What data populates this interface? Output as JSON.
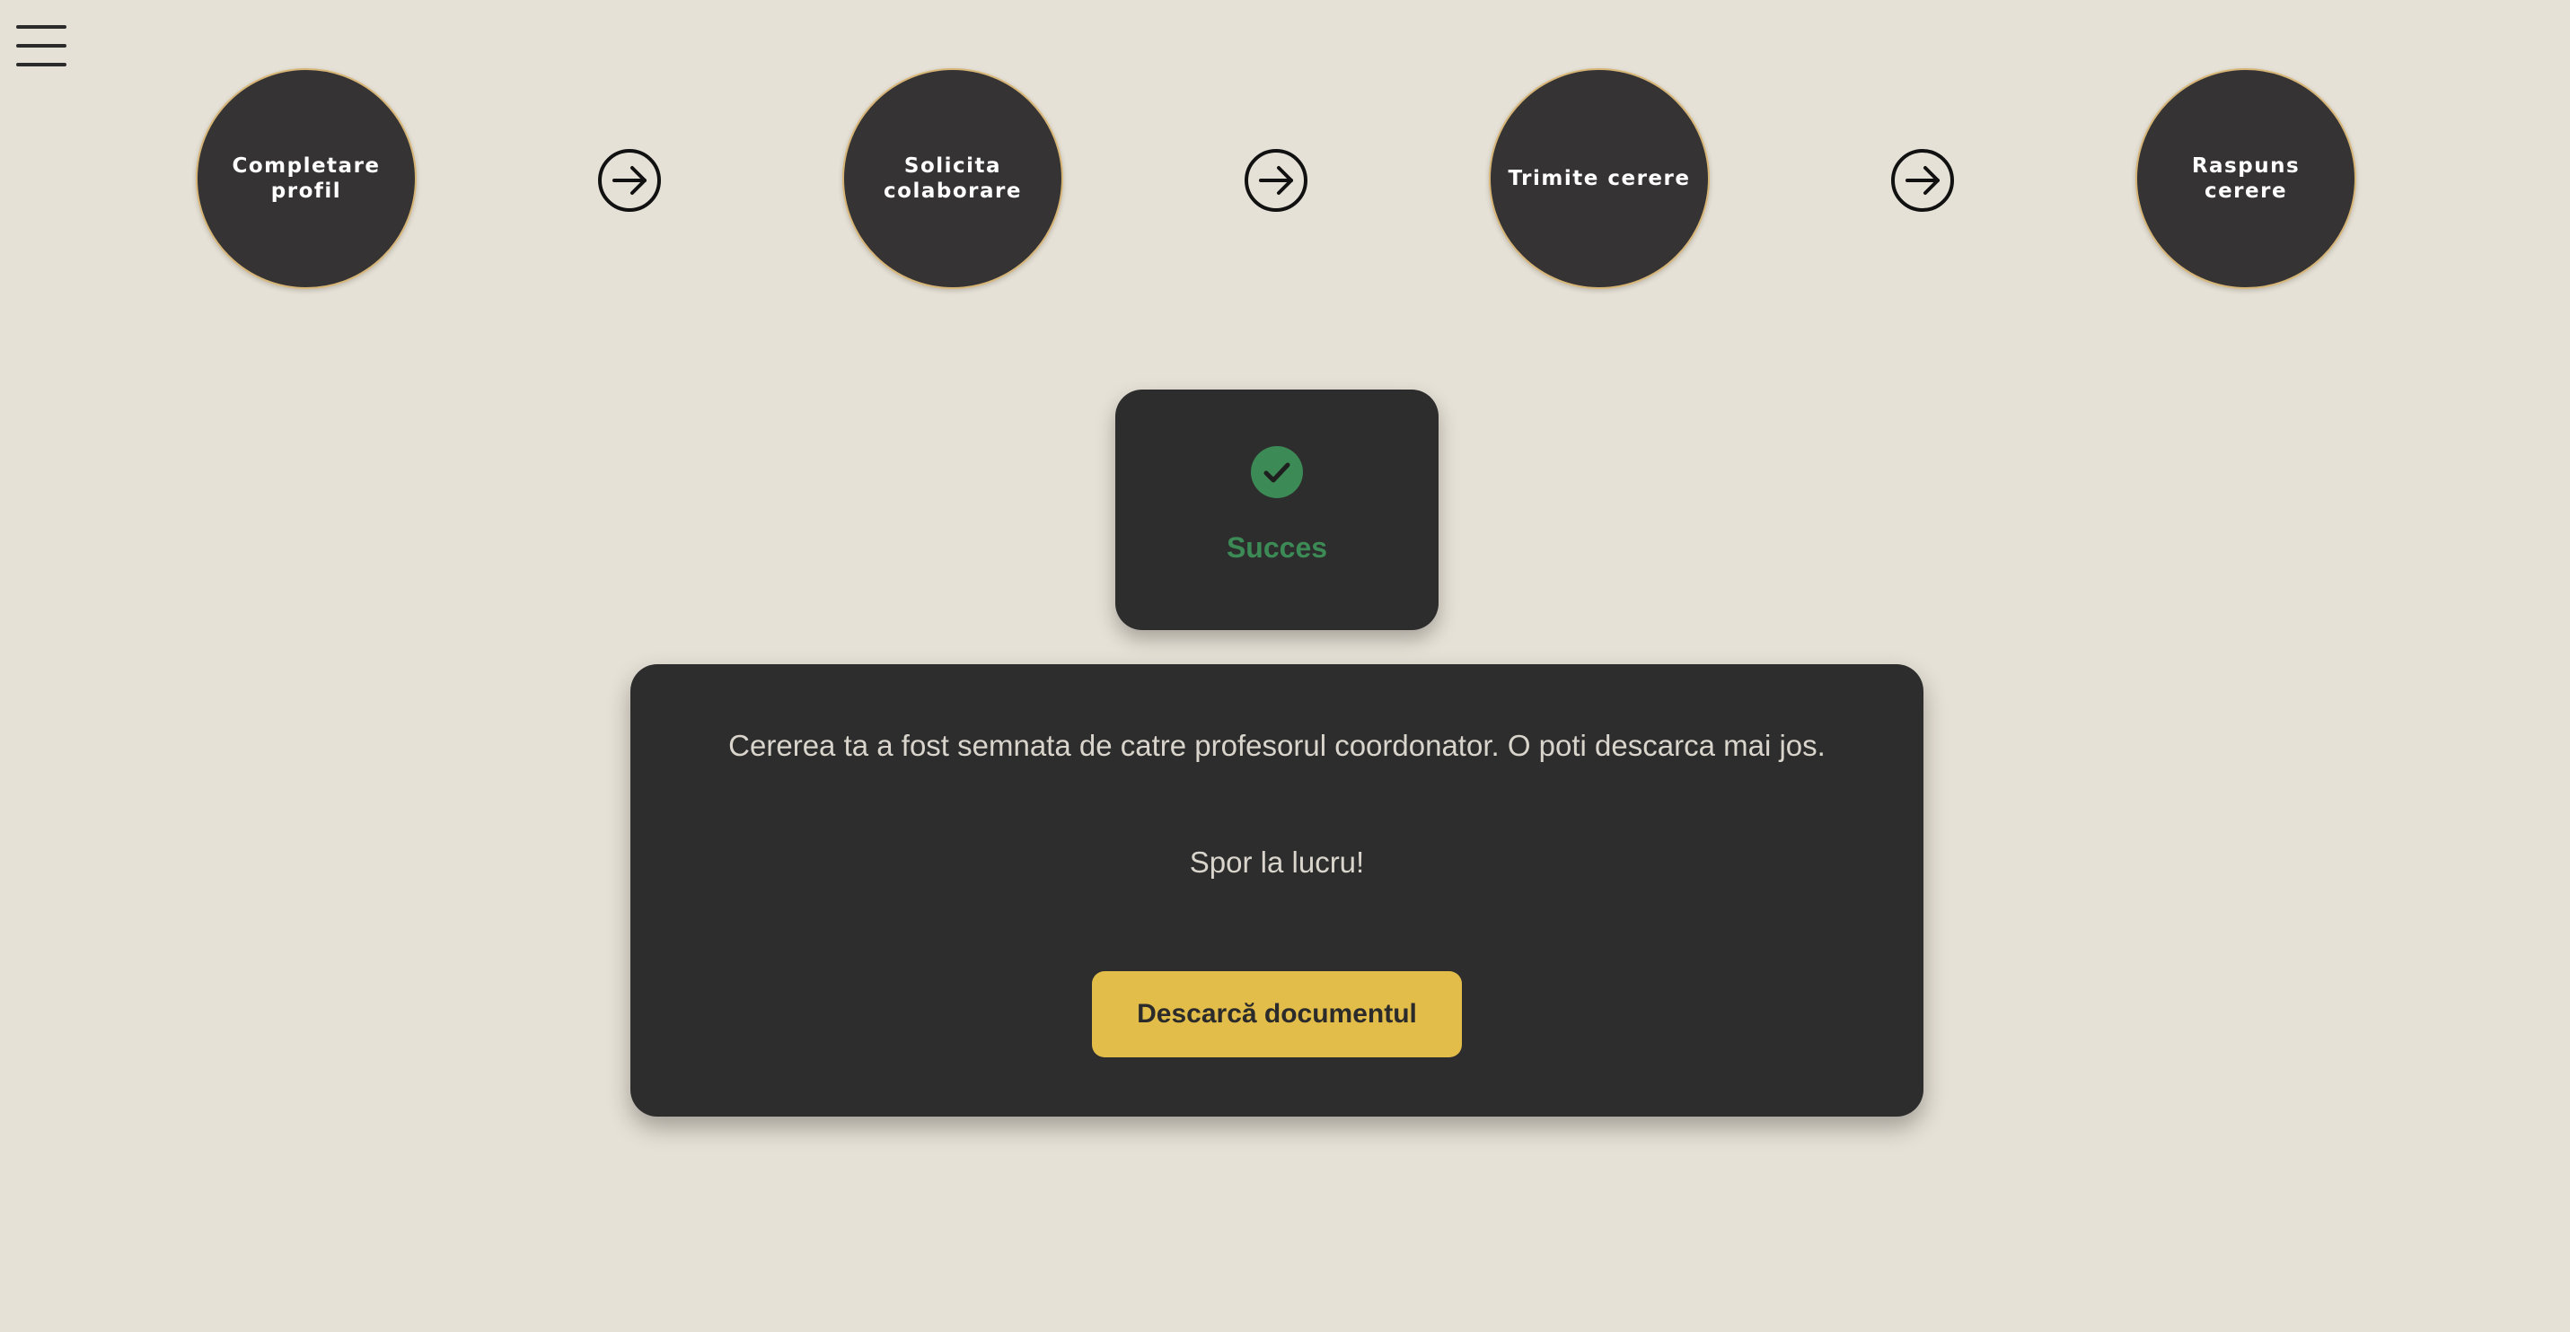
{
  "menu": {
    "icon": "hamburger-menu-icon"
  },
  "steps": [
    {
      "line1": "Completare profil",
      "line2": ""
    },
    {
      "line1": "Solicita",
      "line2": "colaborare"
    },
    {
      "line1": "Trimite cerere",
      "line2": ""
    },
    {
      "line1": "Raspuns cerere",
      "line2": ""
    }
  ],
  "step_arrow_icon": "arrow-right-circle-icon",
  "status": {
    "icon": "check-circle-icon",
    "label": "Succes",
    "color": "#3c8a55"
  },
  "message": {
    "line1": "Cererea ta a fost semnata de catre profesorul coordonator. O poti descarca mai jos.",
    "line2": "Spor la lucru!"
  },
  "download_button": {
    "label": "Descarcă documentul",
    "color": "#e3bd4a"
  },
  "colors": {
    "background": "#e6e1d6",
    "card": "#2d2d2d",
    "step_circle": "#353334",
    "step_border": "#d7b677"
  }
}
